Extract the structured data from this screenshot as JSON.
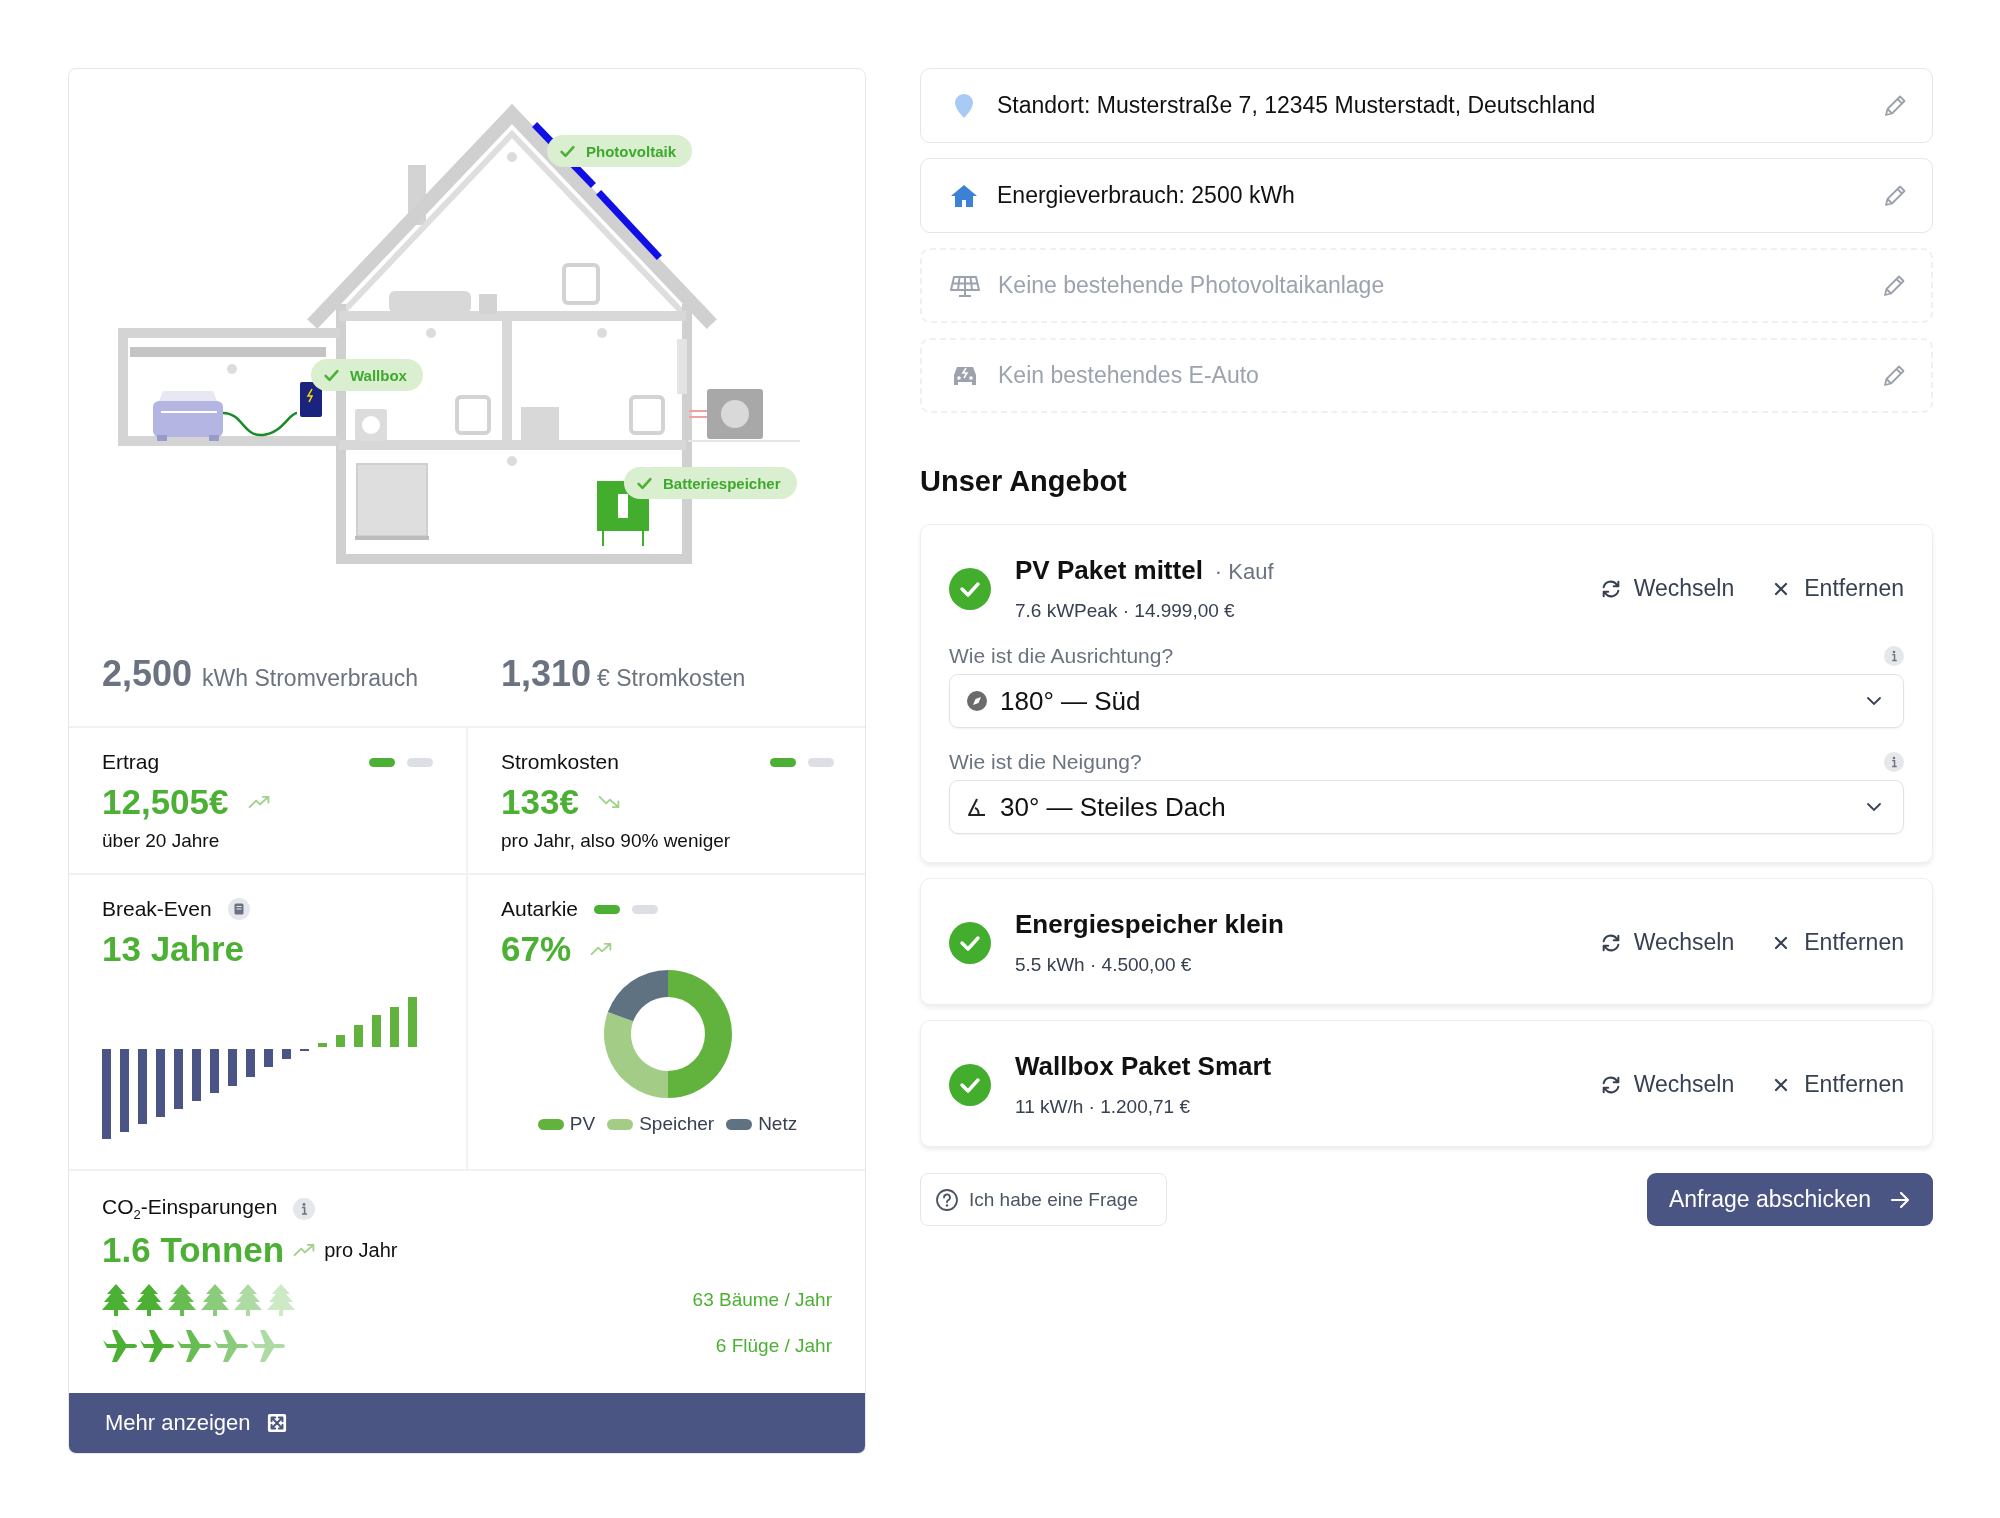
{
  "illustration": {
    "badges": [
      {
        "label": "Photovoltaik",
        "checked": true
      },
      {
        "label": "Wallbox",
        "checked": true
      },
      {
        "label": "Batteriespeicher",
        "checked": true
      }
    ]
  },
  "summary": [
    {
      "value": "2,500",
      "unit": "kWh Stromverbrauch"
    },
    {
      "value": "1,310",
      "unit": "€ Stromkosten"
    }
  ],
  "metrics": [
    {
      "kind": "value",
      "title": "Ertrag",
      "value": "12,505€",
      "rising": true,
      "note": "über 20 Jahre",
      "pages": [
        {
          "selected": true
        },
        {
          "selected": false
        }
      ]
    },
    {
      "kind": "value",
      "title": "Stromkosten",
      "value": "133€",
      "rising": false,
      "note": "pro Jahr, also 90% weniger",
      "pages": [
        {
          "selected": true
        },
        {
          "selected": false
        }
      ]
    },
    {
      "kind": "bars",
      "title": "Break-Even",
      "value": "13 Jahre"
    },
    {
      "kind": "donut",
      "title": "Autarkie",
      "value": "67%",
      "rising": true,
      "pages": [
        {
          "selected": true
        },
        {
          "selected": false
        }
      ],
      "legend": [
        {
          "label": "PV",
          "color": "#62b23e"
        },
        {
          "label": "Speicher",
          "color": "#a3cd86"
        },
        {
          "label": "Netz",
          "color": "#5e7282"
        }
      ]
    }
  ],
  "co2": {
    "title": "CO$_{2}$-Einsparungen",
    "value": "1.6 Tonnen",
    "rising": true,
    "suffix": "pro Jahr",
    "rows": [
      {
        "kind": "tree",
        "text": "63 Bäume / Jahr"
      },
      {
        "kind": "plane",
        "text": "6 Flüge / Jahr"
      }
    ]
  },
  "more_button": "Mehr anzeigen",
  "details": [
    {
      "kind": "location",
      "text": "Standort: Musterstraße 7, 12345 Musterstadt, Deutschland",
      "empty": false
    },
    {
      "kind": "home",
      "text": "Energieverbrauch: 2500 kWh",
      "empty": false
    },
    {
      "kind": "solar",
      "text": "Keine bestehende Photovoltaikanlage",
      "empty": true
    },
    {
      "kind": "car",
      "text": "Kein bestehendes E-Auto",
      "empty": true
    }
  ],
  "offer_heading": "Unser Angebot",
  "offers": [
    {
      "name": "PV Paket mittel",
      "tag": "· Kauf",
      "details": "7.6 kWPeak · 14.999,00 €",
      "checked": true,
      "actions": [
        "Wechseln",
        "Entfernen"
      ],
      "questions": [
        {
          "kind": "compass",
          "label": "Wie ist die Ausrichtung?",
          "value": "180° — Süd"
        },
        {
          "kind": "angle",
          "label": "Wie ist die Neigung?",
          "value": "30° — Steiles Dach"
        }
      ]
    },
    {
      "name": "Energiespeicher klein",
      "details": "5.5 kWh · 4.500,00 €",
      "checked": true,
      "actions": [
        "Wechseln",
        "Entfernen"
      ]
    },
    {
      "name": "Wallbox Paket Smart",
      "details": "11 kW/h · 1.200,71 €",
      "checked": true,
      "actions": [
        "Wechseln",
        "Entfernen"
      ]
    }
  ],
  "question_button": "Ich habe eine Frage",
  "submit_button": "Anfrage abschicken"
}
